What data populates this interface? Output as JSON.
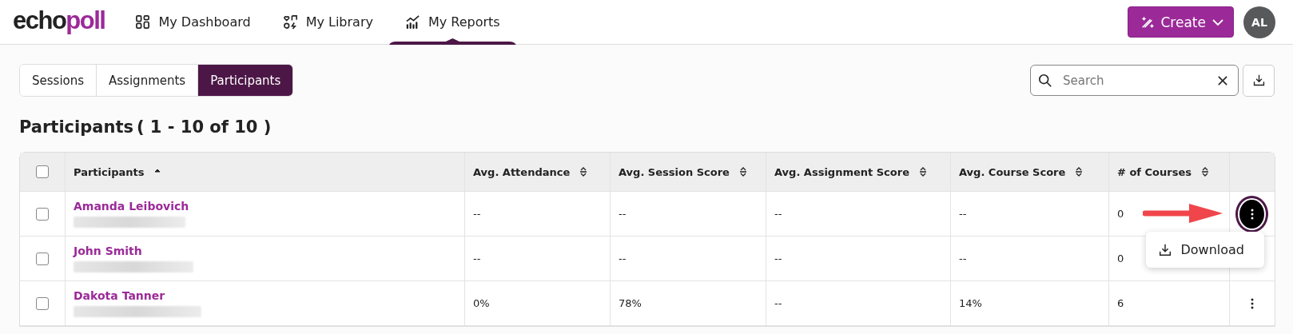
{
  "logo": {
    "first": "echo",
    "second": "poll"
  },
  "nav": [
    {
      "label": "My Dashboard",
      "selected": false
    },
    {
      "label": "My Library",
      "selected": false
    },
    {
      "label": "My Reports",
      "selected": true
    }
  ],
  "create_button": {
    "label": "Create"
  },
  "avatar": {
    "initials": "AL"
  },
  "tabs": [
    {
      "label": "Sessions",
      "selected": false
    },
    {
      "label": "Assignments",
      "selected": false
    },
    {
      "label": "Participants",
      "selected": true
    }
  ],
  "search": {
    "placeholder": "Search"
  },
  "heading": {
    "title": "Participants",
    "range": "( 1 - 10 of 10 )"
  },
  "table": {
    "select_all": {
      "checked": false
    },
    "columns": [
      {
        "label": "Participants",
        "sorted": true
      },
      {
        "label": "Avg. Attendance",
        "sorted": false
      },
      {
        "label": "Avg. Session Score",
        "sorted": false
      },
      {
        "label": "Avg. Assignment Score",
        "sorted": false
      },
      {
        "label": "Avg. Course Score",
        "sorted": false
      },
      {
        "label": "# of Courses",
        "sorted": false
      }
    ],
    "rows": [
      {
        "checked": false,
        "menu_open": true,
        "cells": [
          "Amanda Leibovich",
          "--",
          "--",
          "--",
          "--",
          "0"
        ]
      },
      {
        "checked": false,
        "menu_open": false,
        "cells": [
          "John Smith",
          "--",
          "--",
          "--",
          "--",
          "0"
        ]
      },
      {
        "checked": false,
        "menu_open": false,
        "cells": [
          "Dakota Tanner",
          "0%",
          "78%",
          "--",
          "14%",
          "6"
        ]
      }
    ]
  },
  "row_menu": {
    "items": [
      {
        "label": "Download"
      }
    ]
  },
  "annotation": {
    "kind": "arrow"
  }
}
